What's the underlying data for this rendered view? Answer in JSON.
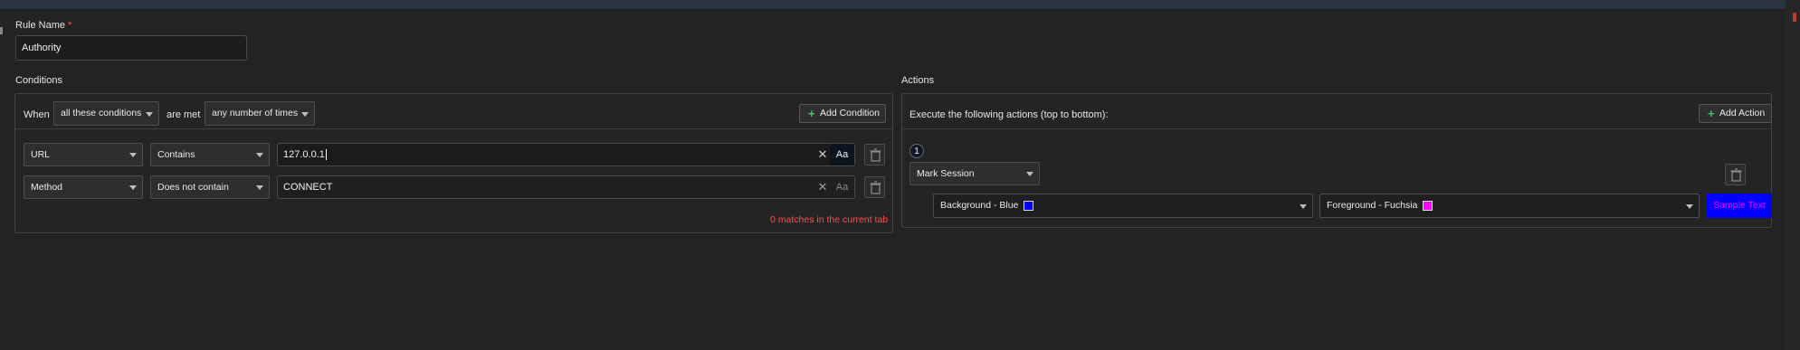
{
  "rule_name": {
    "label": "Rule Name",
    "required_mark": "*",
    "value": "Authority"
  },
  "conditions": {
    "title": "Conditions",
    "when_label": "When",
    "match_mode": "all these conditions",
    "are_met_label": "are met",
    "frequency": "any number of times",
    "add_condition_label": "Add Condition",
    "rows": [
      {
        "field": "URL",
        "operator": "Contains",
        "value": "127.0.0.1",
        "case_label": "Aa"
      },
      {
        "field": "Method",
        "operator": "Does not contain",
        "value": "CONNECT",
        "case_label": "Aa"
      }
    ],
    "match_status": "0 matches in the current tab"
  },
  "actions": {
    "title": "Actions",
    "description": "Execute the following actions (top to bottom):",
    "add_action_label": "Add Action",
    "items": [
      {
        "index": "1",
        "type": "Mark Session",
        "background": "Background - Blue",
        "background_color": "#0000ff",
        "foreground": "Foreground - Fuchsia",
        "foreground_color": "#ff00ff",
        "sample_text": "Sample Text"
      }
    ]
  },
  "icons": {
    "clear": "close-icon",
    "delete": "trash-icon",
    "dropdown": "chevron-down-icon",
    "add": "plus-icon"
  },
  "colors": {
    "background": "#232323",
    "border": "#444444",
    "accent_green": "#41c36a",
    "error_red": "#ff4d4f"
  }
}
